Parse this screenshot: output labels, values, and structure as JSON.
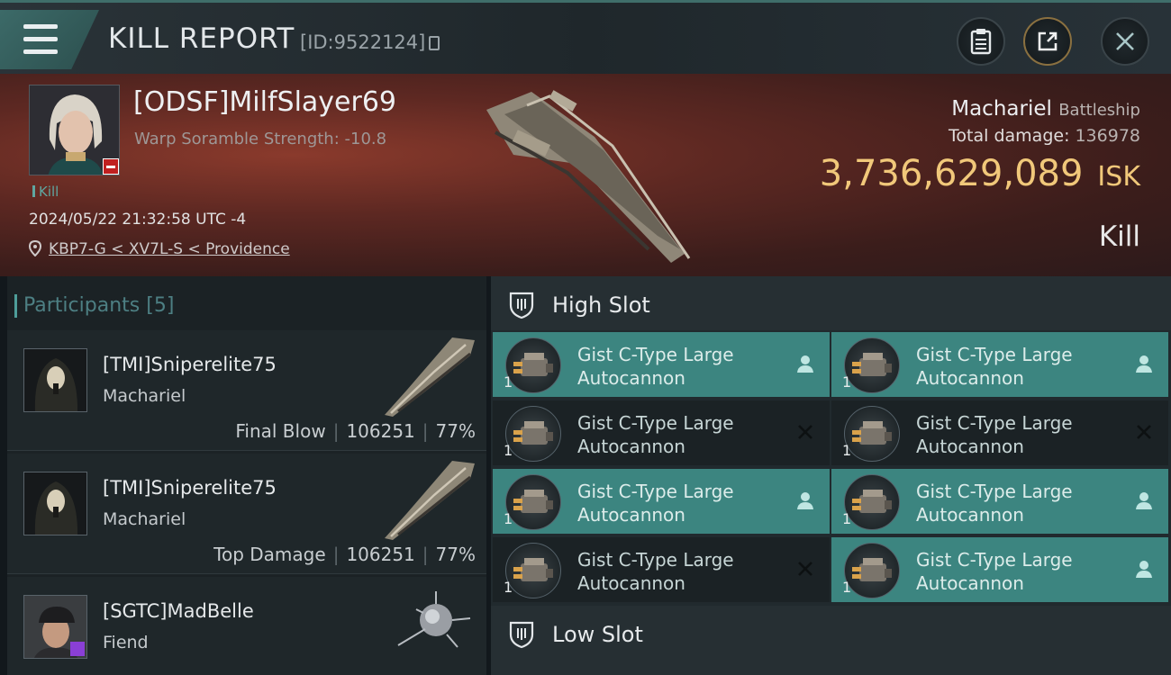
{
  "header": {
    "title": "KILL REPORT",
    "report_id": "[ID:9522124]"
  },
  "icons": {
    "menu": "menu-icon",
    "clipboard": "clipboard-icon",
    "share": "share-icon",
    "close": "close-icon",
    "location": "map-pin-icon",
    "slot": "shield-icon",
    "pilot_status": "user-icon",
    "offline": "x-icon"
  },
  "colors": {
    "accent": "#3c8580",
    "isk": "#f1c87a",
    "hero_bg": "#5d2822"
  },
  "victim": {
    "name": "[ODSF]MilfSlayer69",
    "scramble": "Warp Soramble Strength: -10.8",
    "kill_tag": "Kill",
    "datetime": "2024/05/22 21:32:58 UTC -4",
    "location": "KBP7-G < XV7L-S < Providence",
    "ship_name": "Machariel",
    "ship_class": "Battleship",
    "total_damage_label": "Total damage:",
    "total_damage": "136978",
    "isk_value": "3,736,629,089",
    "isk_unit": "ISK",
    "result": "Kill"
  },
  "participants": {
    "label": "Participants",
    "count": "[5]",
    "rows": [
      {
        "name": "[TMI]Sniperelite75",
        "ship": "Machariel",
        "role": "Final Blow",
        "damage": "106251",
        "percent": "77%"
      },
      {
        "name": "[TMI]Sniperelite75",
        "ship": "Machariel",
        "role": "Top Damage",
        "damage": "106251",
        "percent": "77%"
      },
      {
        "name": "[SGTC]MadBelle",
        "ship": "Fiend",
        "role": "",
        "damage": "",
        "percent": ""
      }
    ]
  },
  "fitting": {
    "high_slot_label": "High Slot",
    "low_slot_label": "Low Slot",
    "high_slots": [
      {
        "name": "Gist C-Type Large Autocannon",
        "qty": "1",
        "state": "online"
      },
      {
        "name": "Gist C-Type Large Autocannon",
        "qty": "1",
        "state": "online"
      },
      {
        "name": "Gist C-Type Large Autocannon",
        "qty": "1",
        "state": "offline"
      },
      {
        "name": "Gist C-Type Large Autocannon",
        "qty": "1",
        "state": "offline"
      },
      {
        "name": "Gist C-Type Large Autocannon",
        "qty": "1",
        "state": "online"
      },
      {
        "name": "Gist C-Type Large Autocannon",
        "qty": "1",
        "state": "online"
      },
      {
        "name": "Gist C-Type Large Autocannon",
        "qty": "1",
        "state": "offline"
      },
      {
        "name": "Gist C-Type Large Autocannon",
        "qty": "1",
        "state": "online"
      }
    ]
  }
}
